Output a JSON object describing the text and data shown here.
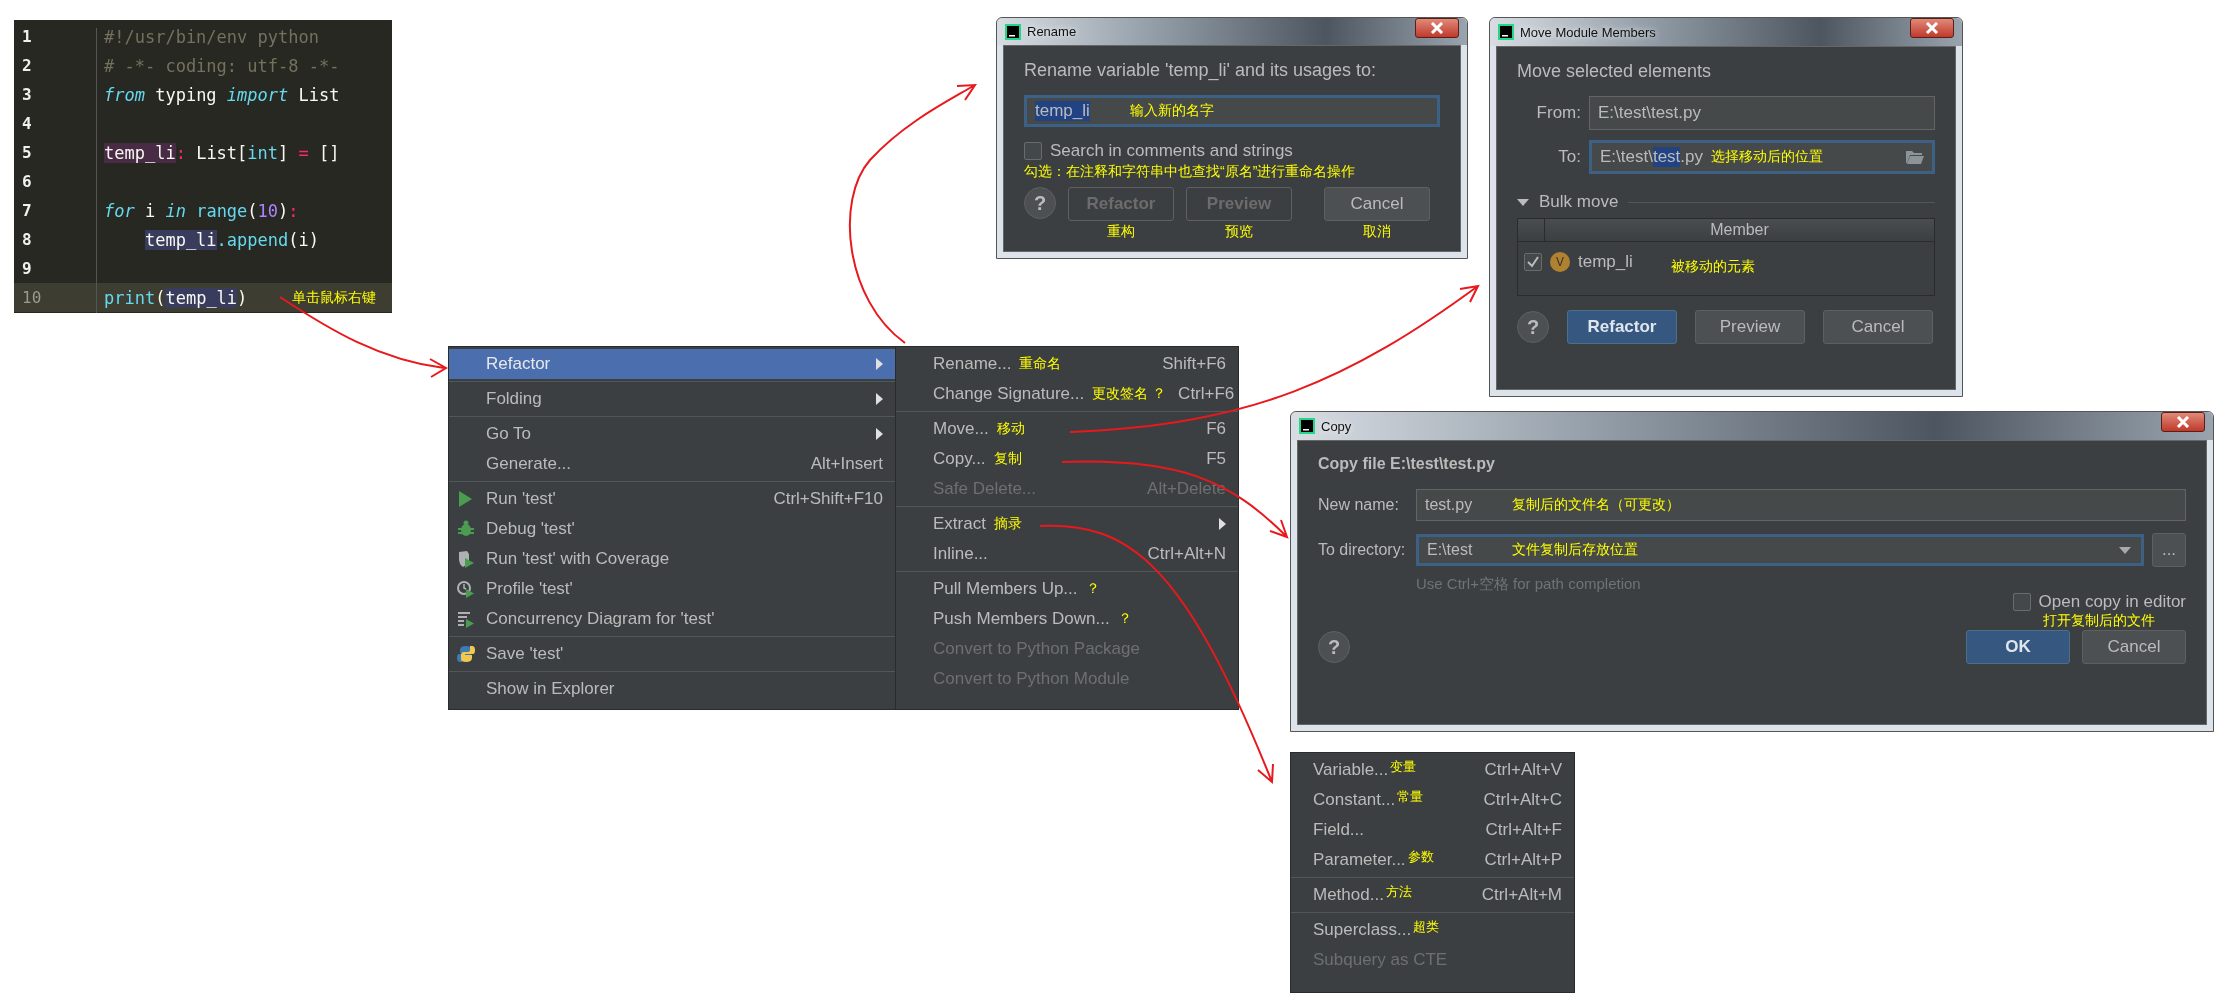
{
  "editor": {
    "annotation": "单击鼠标右键",
    "lines": [
      {
        "number": "1",
        "current": false,
        "tokens": [
          {
            "kind": "comment",
            "text": "#!/usr/bin/env python"
          }
        ]
      },
      {
        "number": "2",
        "current": false,
        "tokens": [
          {
            "kind": "comment",
            "text": "# -*- coding: utf-8 -*-"
          }
        ]
      },
      {
        "number": "3",
        "current": false,
        "tokens": [
          {
            "kind": "keyword",
            "text": "from"
          },
          {
            "kind": "plain",
            "text": " typing "
          },
          {
            "kind": "keyword",
            "text": "import"
          },
          {
            "kind": "plain",
            "text": " List"
          }
        ]
      },
      {
        "number": "4",
        "current": false
      },
      {
        "number": "5",
        "current": false,
        "tokens": [
          {
            "kind": "definition",
            "text": "temp_li"
          },
          {
            "kind": "operator",
            "text": ":"
          },
          {
            "kind": "plain",
            "text": " List["
          },
          {
            "kind": "builtin",
            "text": "int"
          },
          {
            "kind": "plain",
            "text": "] "
          },
          {
            "kind": "operator",
            "text": "="
          },
          {
            "kind": "plain",
            "text": " []"
          }
        ]
      },
      {
        "number": "6",
        "current": false
      },
      {
        "number": "7",
        "current": false,
        "tokens": [
          {
            "kind": "keyword",
            "text": "for"
          },
          {
            "kind": "plain",
            "text": " i "
          },
          {
            "kind": "keyword",
            "text": "in"
          },
          {
            "kind": "builtin",
            "text": " range"
          },
          {
            "kind": "plain",
            "text": "("
          },
          {
            "kind": "number",
            "text": "10"
          },
          {
            "kind": "plain",
            "text": ")"
          },
          {
            "kind": "operator",
            "text": ":"
          }
        ]
      },
      {
        "number": "8",
        "current": false,
        "indented": true,
        "tokens": [
          {
            "kind": "usage",
            "text": "temp_li"
          },
          {
            "kind": "builtin",
            "text": ".append"
          },
          {
            "kind": "plain",
            "text": "(i)"
          }
        ]
      },
      {
        "number": "9",
        "current": false
      },
      {
        "number": "10",
        "current": true,
        "tokens": [
          {
            "kind": "builtin",
            "text": "print"
          },
          {
            "kind": "plain",
            "text": "("
          },
          {
            "kind": "usage",
            "text": "temp_li"
          },
          {
            "kind": "plain",
            "text": ")"
          }
        ]
      }
    ]
  },
  "context_menu": {
    "main_groups": [
      {
        "items": [
          {
            "label": "Refactor",
            "submenu": true,
            "selected": true,
            "disabled": false
          }
        ]
      },
      {
        "items": [
          {
            "label": "Folding",
            "submenu": true,
            "selected": false,
            "disabled": false
          }
        ]
      },
      {
        "items": [
          {
            "label": "Go To",
            "submenu": true,
            "selected": false,
            "disabled": false
          },
          {
            "label": "Generate...",
            "shortcut": "Alt+Insert",
            "submenu": false,
            "selected": false,
            "disabled": false
          }
        ]
      },
      {
        "items": [
          {
            "label": "Run 'test'",
            "shortcut": "Ctrl+Shift+F10",
            "kind": "run",
            "submenu": false,
            "selected": false,
            "disabled": false
          },
          {
            "label": "Debug 'test'",
            "kind": "debug",
            "submenu": false,
            "selected": false,
            "disabled": false
          },
          {
            "label": "Run 'test' with Coverage",
            "kind": "coverage",
            "submenu": false,
            "selected": false,
            "disabled": false
          },
          {
            "label": "Profile 'test'",
            "kind": "profile",
            "submenu": false,
            "selected": false,
            "disabled": false
          },
          {
            "label": "Concurrency Diagram for 'test'",
            "kind": "concurrency",
            "submenu": false,
            "selected": false,
            "disabled": false
          }
        ]
      },
      {
        "items": [
          {
            "label": "Save 'test'",
            "kind": "python",
            "submenu": false,
            "selected": false,
            "disabled": false
          }
        ]
      },
      {
        "items": [
          {
            "label": "Show in Explorer",
            "submenu": false,
            "selected": false,
            "disabled": false
          }
        ]
      }
    ],
    "refactor_groups": [
      {
        "items": [
          {
            "label": "Rename...",
            "note": "重命名",
            "shortcut": "Shift+F6",
            "submenu": false,
            "selected": false,
            "disabled": false
          },
          {
            "label": "Change Signature...",
            "note": "更改签名 ？",
            "shortcut": "Ctrl+F6",
            "submenu": false,
            "selected": false,
            "disabled": false
          }
        ]
      },
      {
        "items": [
          {
            "label": "Move...",
            "note": "移动",
            "shortcut": "F6",
            "submenu": false,
            "selected": false,
            "disabled": false
          },
          {
            "label": "Copy...",
            "note": "复制",
            "shortcut": "F5",
            "submenu": false,
            "selected": false,
            "disabled": false
          },
          {
            "label": "Safe Delete...",
            "shortcut": "Alt+Delete",
            "submenu": false,
            "selected": false,
            "disabled": true
          }
        ]
      },
      {
        "items": [
          {
            "label": "Extract",
            "note": "摘录",
            "submenu": true,
            "selected": false,
            "disabled": false
          },
          {
            "label": "Inline...",
            "shortcut": "Ctrl+Alt+N",
            "submenu": false,
            "selected": false,
            "disabled": false
          }
        ]
      },
      {
        "items": [
          {
            "label": "Pull Members Up...",
            "note": "？",
            "submenu": false,
            "selected": false,
            "disabled": false
          },
          {
            "label": "Push Members Down...",
            "note": "？",
            "submenu": false,
            "selected": false,
            "disabled": false
          },
          {
            "label": "Convert to Python Package",
            "submenu": false,
            "selected": false,
            "disabled": true
          },
          {
            "label": "Convert to Python Module",
            "submenu": false,
            "selected": false,
            "disabled": true
          }
        ]
      }
    ]
  },
  "extract_menu": {
    "groups": [
      {
        "items": [
          {
            "label": "Variable...",
            "note": "变量",
            "shortcut": "Ctrl+Alt+V",
            "selected": false,
            "disabled": false
          },
          {
            "label": "Constant...",
            "note": "常量",
            "shortcut": "Ctrl+Alt+C",
            "selected": false,
            "disabled": false
          },
          {
            "label": "Field...",
            "shortcut": "Ctrl+Alt+F",
            "selected": false,
            "disabled": false
          },
          {
            "label": "Parameter...",
            "note": "参数",
            "shortcut": "Ctrl+Alt+P",
            "selected": false,
            "disabled": false
          }
        ]
      },
      {
        "items": [
          {
            "label": "Method...",
            "note": "方法",
            "shortcut": "Ctrl+Alt+M",
            "selected": false,
            "disabled": false
          }
        ]
      },
      {
        "items": [
          {
            "label": "Superclass...",
            "note": "超类",
            "selected": false,
            "disabled": false
          },
          {
            "label": "Subquery as CTE",
            "selected": false,
            "disabled": true
          }
        ]
      }
    ]
  },
  "rename_dialog": {
    "title": "Rename",
    "prompt": "Rename variable 'temp_li' and its usages to:",
    "field": {
      "value": "temp_li",
      "selected": true,
      "annotation": "输入新的名字"
    },
    "option": {
      "label": "Search in comments and strings",
      "checked": false,
      "annotation": "勾选：在注释和字符串中也查找“原名”进行重命名操作"
    },
    "help": "?",
    "buttons": [
      {
        "label": "Refactor",
        "default": false,
        "disabled": true,
        "annotation": "重构"
      },
      {
        "label": "Preview",
        "default": false,
        "disabled": true,
        "annotation": "预览"
      },
      {
        "label": "Cancel",
        "default": false,
        "disabled": false,
        "annotation": "取消"
      }
    ]
  },
  "move_dialog": {
    "title": "Move Module Members",
    "heading": "Move selected elements",
    "from": {
      "label": "From:",
      "value": "E:\\test\\test.py"
    },
    "to": {
      "label": "To:",
      "value_parts": [
        {
          "text": "E:\\test\\",
          "selected": false
        },
        {
          "text": "test",
          "selected": true
        },
        {
          "text": ".py",
          "selected": false
        }
      ],
      "annotation": "选择移动后的位置"
    },
    "bulk": {
      "label": "Bulk move",
      "expanded": true
    },
    "table": {
      "columns": [
        "Member"
      ],
      "rows": [
        {
          "checked": true,
          "badge": "V",
          "name": "temp_li",
          "annotation": "被移动的元素"
        }
      ]
    },
    "help": "?",
    "buttons": [
      {
        "label": "Refactor",
        "default": true,
        "disabled": false
      },
      {
        "label": "Preview",
        "default": false,
        "disabled": false
      },
      {
        "label": "Cancel",
        "default": false,
        "disabled": false
      }
    ]
  },
  "copy_dialog": {
    "title": "Copy",
    "heading": "Copy file E:\\test\\test.py",
    "new_name": {
      "label": "New name:",
      "value": "test.py",
      "annotation": "复制后的文件名（可更改）"
    },
    "directory": {
      "label": "To directory:",
      "value": "E:\\test",
      "annotation": "文件复制后存放位置",
      "browse": "..."
    },
    "hint": "Use Ctrl+空格 for path completion",
    "option": {
      "label": "Open copy in editor",
      "checked": false,
      "annotation": "打开复制后的文件"
    },
    "help": "?",
    "buttons": [
      {
        "label": "OK",
        "default": true,
        "disabled": false
      },
      {
        "label": "Cancel",
        "default": false,
        "disabled": false
      }
    ]
  }
}
